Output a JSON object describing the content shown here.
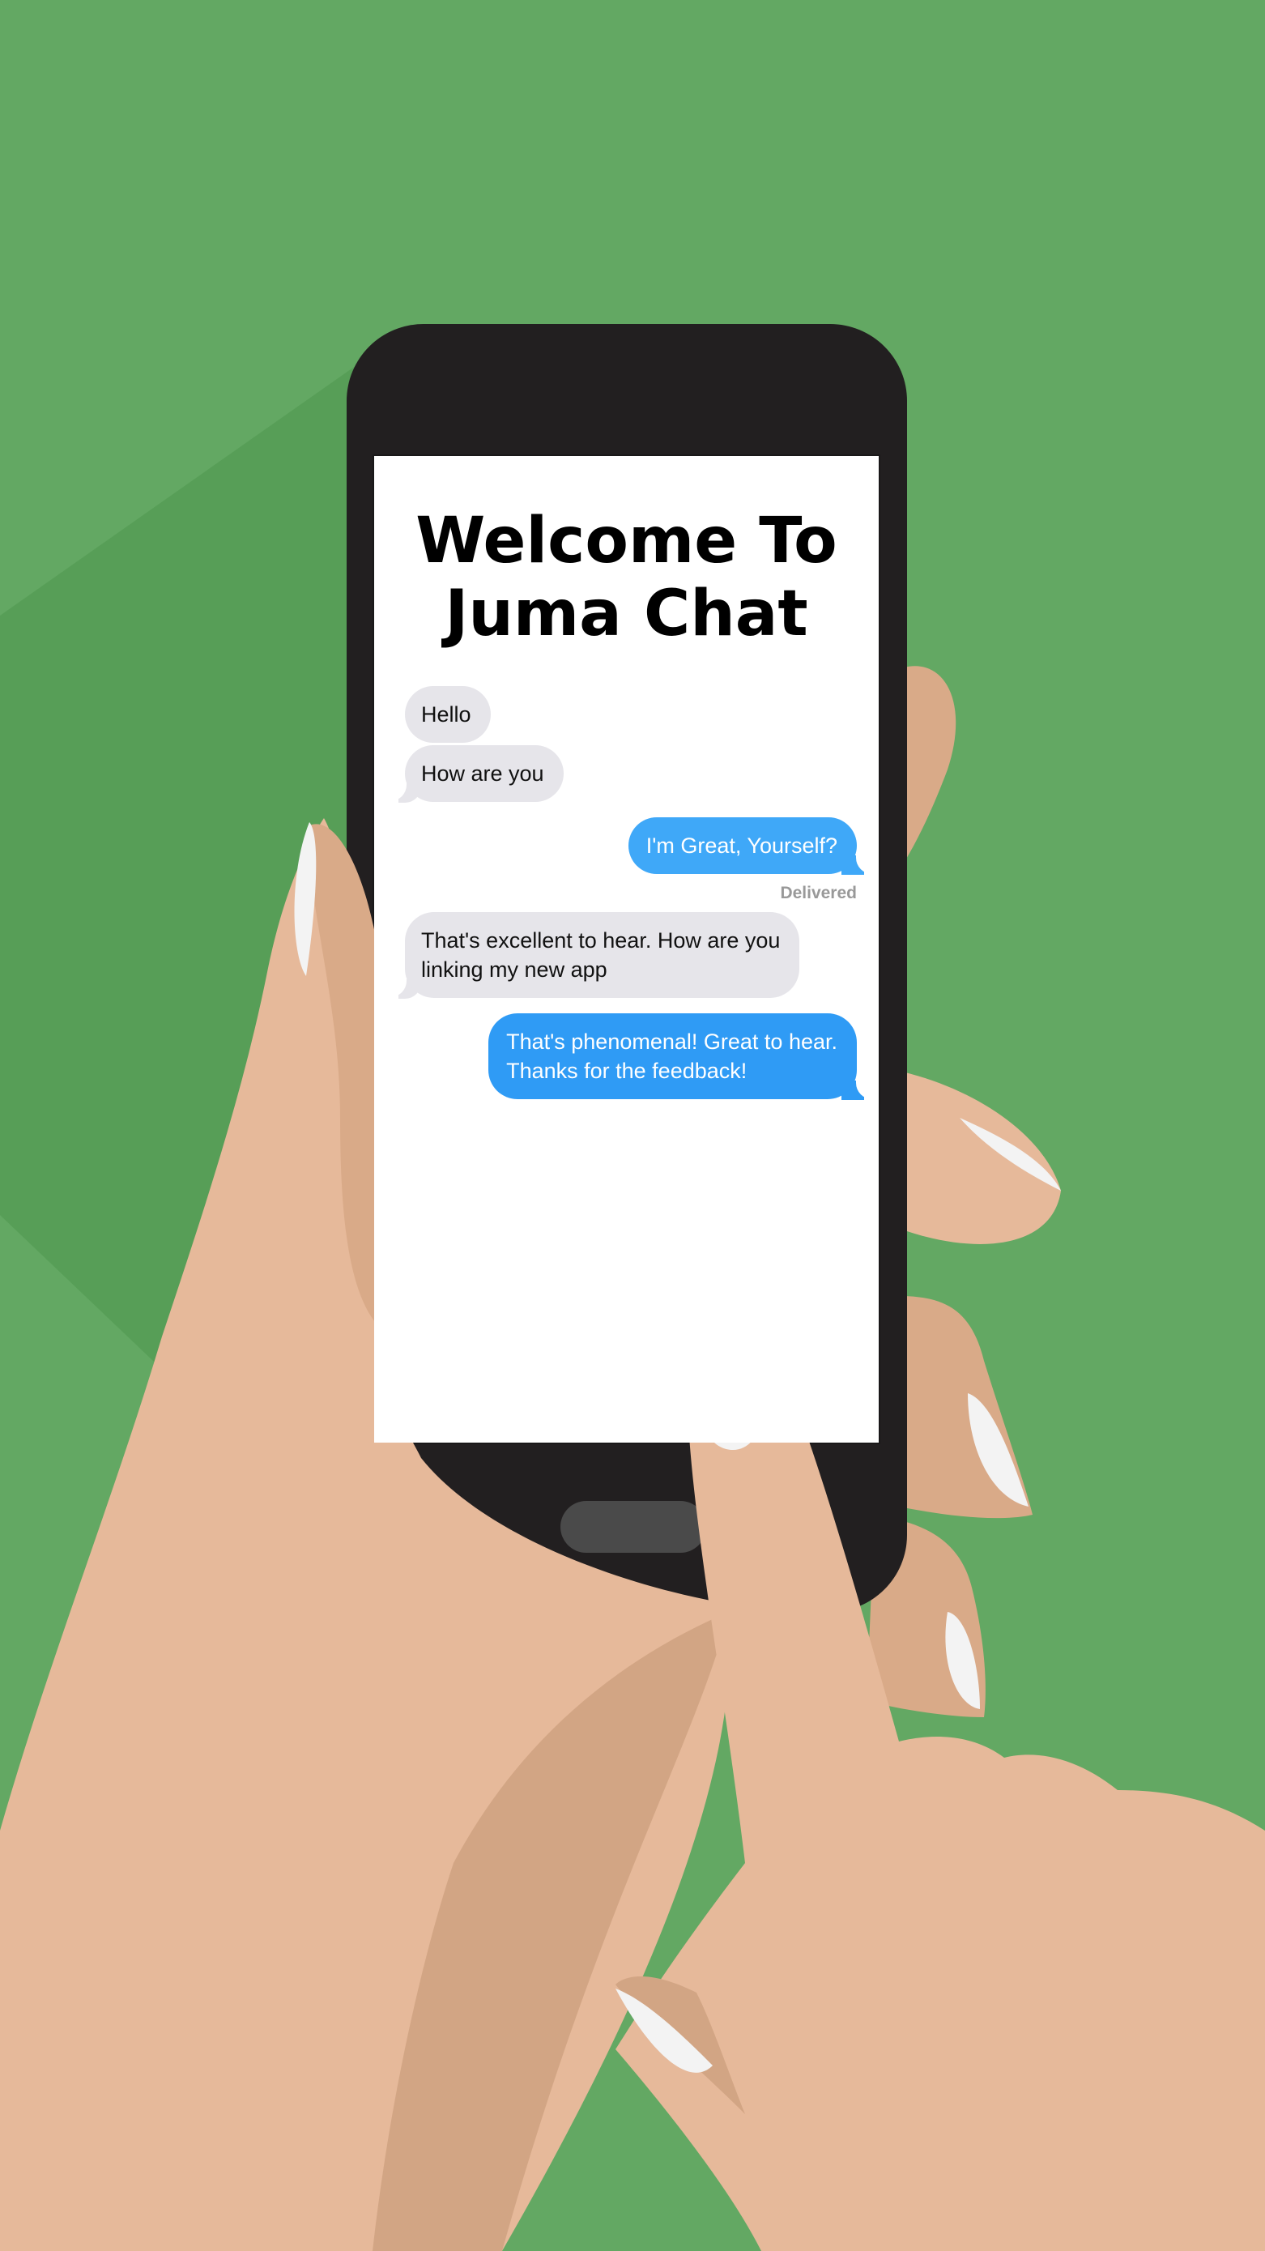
{
  "app": {
    "title_line1": "Welcome To",
    "title_line2": "Juma Chat"
  },
  "chat": {
    "messages": [
      {
        "direction": "incoming",
        "text": "Hello"
      },
      {
        "direction": "incoming",
        "text": "How are you"
      },
      {
        "direction": "outgoing",
        "text": "I'm Great, Yourself?"
      },
      {
        "direction": "incoming",
        "lines": [
          "That's excellent to hear. How are you",
          "linking my new app"
        ]
      },
      {
        "direction": "outgoing",
        "lines": [
          "That's phenomenal! Great to hear.",
          "Thanks for the feedback!"
        ]
      }
    ],
    "delivered_label": "Delivered"
  },
  "colors": {
    "background": "#63a863",
    "incoming_bubble": "#e6e5ea",
    "outgoing_bubble": "#3fa8f8",
    "outgoing_bubble_alt": "#2f9bf5",
    "phone_body": "#221f20",
    "skin": "#e6b99a"
  },
  "icons": {
    "home_button": "home-button-pill"
  }
}
